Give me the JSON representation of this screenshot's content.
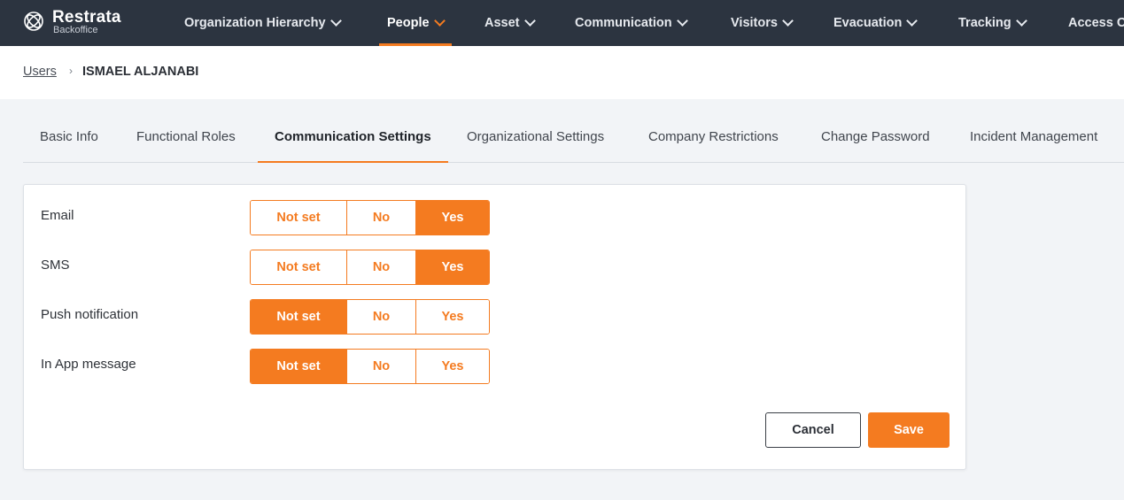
{
  "app": {
    "name": "Restrata",
    "subtitle": "Backoffice",
    "logo_icon": "restrata-logo-icon"
  },
  "nav": {
    "items": [
      {
        "label": "Organization Hierarchy",
        "active": false
      },
      {
        "label": "People",
        "active": true
      },
      {
        "label": "Asset",
        "active": false
      },
      {
        "label": "Communication",
        "active": false
      },
      {
        "label": "Visitors",
        "active": false
      },
      {
        "label": "Evacuation",
        "active": false
      },
      {
        "label": "Tracking",
        "active": false
      },
      {
        "label": "Access C",
        "active": false
      }
    ],
    "accent_color": "#f47b20"
  },
  "breadcrumb": {
    "parent": "Users",
    "separator": "›",
    "current": "ISMAEL ALJANABI"
  },
  "tabs": [
    {
      "label": "Basic Info",
      "active": false
    },
    {
      "label": "Functional Roles",
      "active": false
    },
    {
      "label": "Communication Settings",
      "active": true
    },
    {
      "label": "Organizational Settings",
      "active": false
    },
    {
      "label": "Company Restrictions",
      "active": false
    },
    {
      "label": "Change Password",
      "active": false
    },
    {
      "label": "Incident Management",
      "active": false
    }
  ],
  "settings": {
    "options": [
      "Not set",
      "No",
      "Yes"
    ],
    "rows": [
      {
        "label": "Email",
        "selected": "Yes"
      },
      {
        "label": "SMS",
        "selected": "Yes"
      },
      {
        "label": "Push notification",
        "selected": "Not set"
      },
      {
        "label": "In App message",
        "selected": "Not set"
      }
    ]
  },
  "actions": {
    "cancel_label": "Cancel",
    "save_label": "Save"
  },
  "colors": {
    "accent": "#f47b20",
    "nav_bg": "#2c3440",
    "page_bg": "#f2f4f7"
  }
}
